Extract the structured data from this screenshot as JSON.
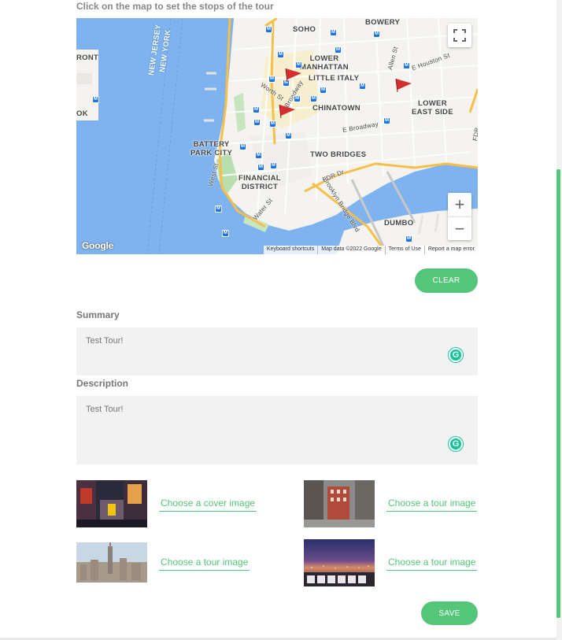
{
  "map": {
    "title": "Click on the map to set the stops of the tour",
    "labels": {
      "soho": "SOHO",
      "bowery": "BOWERY",
      "lower_manhattan": "LOWER\nMANHATTAN",
      "little_italy": "LITTLE ITALY",
      "chinatown": "CHINATOWN",
      "lower_east_side": "LOWER\nEAST SIDE",
      "battery_park_city": "BATTERY\nPARK CITY",
      "two_bridges": "TWO BRIDGES",
      "financial_district": "FINANCIAL\nDISTRICT",
      "dumbo": "DUMBO",
      "new_jersey": "NEW JERSEY",
      "new_york": "NEW YORK",
      "front": "RONT",
      "ok": "OK",
      "brooklyn_bridge": "Brooklyn Bridge Blvd",
      "fdr": "FDR Dr",
      "e_broadway": "E Broadway",
      "west_st": "West St",
      "water_st": "Water St",
      "worth_st": "Worth St",
      "broadway": "Broadway",
      "allen_st": "Allen St",
      "e_houston": "E Houston St",
      "fdr_vert": "FDR"
    },
    "google_logo": "Google",
    "attribution": [
      "Keyboard shortcuts",
      "Map data ©2022 Google",
      "Terms of Use",
      "Report a map error"
    ],
    "zoom_in": "+",
    "zoom_out": "−",
    "metro_glyph": "M",
    "stops": 3
  },
  "clear_button": "CLEAR",
  "summary": {
    "label": "Summary",
    "value": "Test Tour!"
  },
  "description": {
    "label": "Description",
    "value": "Test Tour!"
  },
  "grammarly_glyph": "G",
  "images": {
    "cover": "Choose a cover image",
    "tour1": "Choose a tour image",
    "tour2": "Choose a tour image",
    "tour3": "Choose a tour image"
  },
  "save_button": "SAVE",
  "colors": {
    "accent": "#55c57a",
    "water": "#7fb3ef",
    "land": "#f4f3f0",
    "flag": "#d32f2f"
  }
}
